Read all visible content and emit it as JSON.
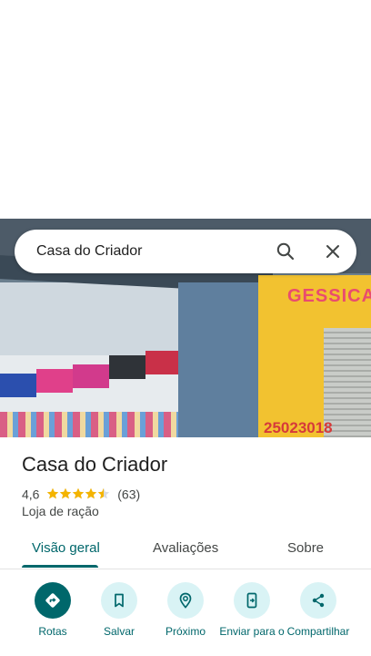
{
  "search": {
    "query": "Casa do Criador"
  },
  "photo": {
    "ad_text": "GESSICAM",
    "phone_text": "25023018"
  },
  "place": {
    "name": "Casa do Criador",
    "rating": "4,6",
    "stars": 4.5,
    "reviews": "(63)",
    "category": "Loja de ração"
  },
  "tabs": [
    {
      "label": "Visão geral",
      "active": true
    },
    {
      "label": "Avaliações",
      "active": false
    },
    {
      "label": "Sobre",
      "active": false
    }
  ],
  "actions": [
    {
      "label": "Rotas",
      "icon": "directions-icon"
    },
    {
      "label": "Salvar",
      "icon": "bookmark-icon"
    },
    {
      "label": "Próximo",
      "icon": "nearby-icon"
    },
    {
      "label": "Enviar para o",
      "icon": "send-to-phone-icon"
    },
    {
      "label": "Compartilhar",
      "icon": "share-icon"
    }
  ],
  "colors": {
    "accent": "#00676b",
    "accent_light": "#d9f3f5",
    "star": "#f4b400"
  }
}
